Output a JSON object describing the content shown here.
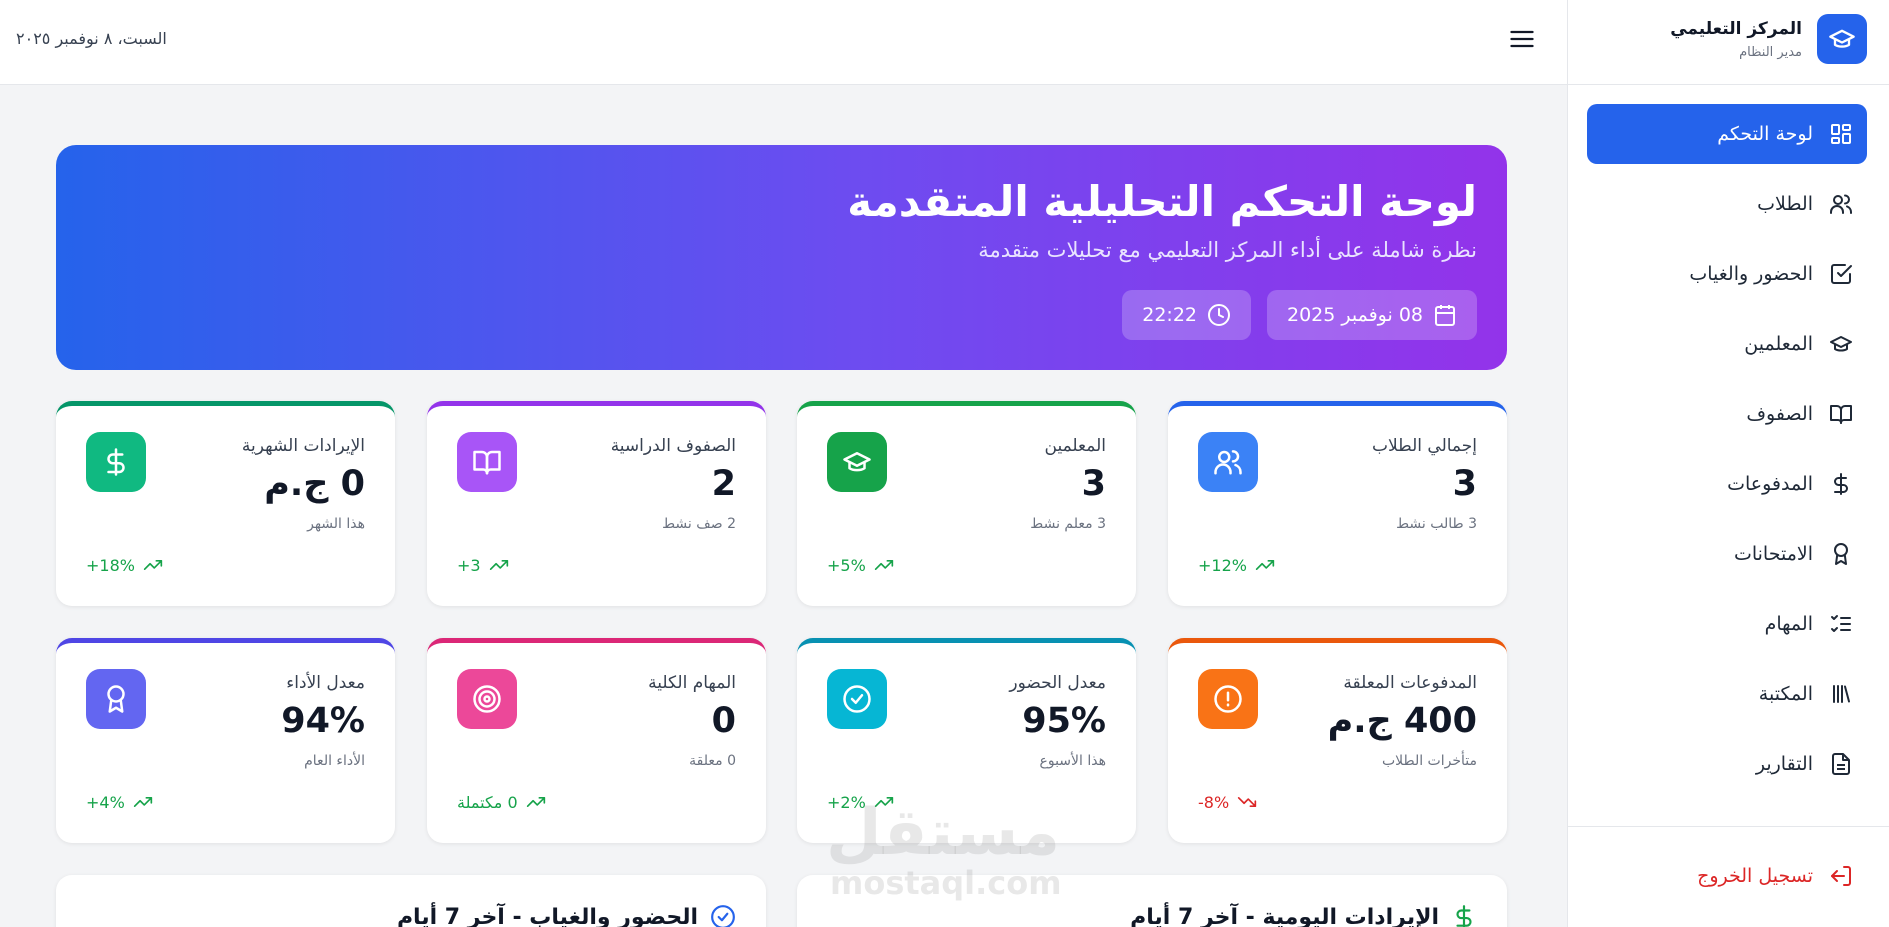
{
  "brand": {
    "title": "المركز التعليمي",
    "subtitle": "مدير النظام",
    "icon": "graduation-cap-icon"
  },
  "topbar": {
    "date": "السبت، ٨ نوفمبر ٢٠٢٥",
    "menu_icon": "menu-icon"
  },
  "sidebar": {
    "items": [
      {
        "label": "لوحة التحكم",
        "icon": "dashboard-icon",
        "active": true
      },
      {
        "label": "الطلاب",
        "icon": "users-icon"
      },
      {
        "label": "الحضور والغياب",
        "icon": "check-square-icon"
      },
      {
        "label": "المعلمين",
        "icon": "graduation-cap-icon"
      },
      {
        "label": "الصفوف",
        "icon": "book-icon"
      },
      {
        "label": "المدفوعات",
        "icon": "dollar-icon"
      },
      {
        "label": "الامتحانات",
        "icon": "award-icon"
      },
      {
        "label": "المهام",
        "icon": "list-checks-icon"
      },
      {
        "label": "المكتبة",
        "icon": "library-icon"
      },
      {
        "label": "التقارير",
        "icon": "file-text-icon"
      }
    ],
    "logout": {
      "label": "تسجيل الخروج",
      "icon": "logout-icon"
    }
  },
  "hero": {
    "title": "لوحة التحكم التحليلية المتقدمة",
    "subtitle": "نظرة شاملة على أداء المركز التعليمي مع تحليلات متقدمة",
    "date_chip": "08 نوفمبر 2025",
    "time_chip": "22:22"
  },
  "stats": [
    {
      "title": "إجمالي الطلاب",
      "value": "3",
      "sub": "3 طالب نشط",
      "trend": "+12%",
      "trend_dir": "up",
      "color": "#3b82f6",
      "icon": "users-icon"
    },
    {
      "title": "المعلمين",
      "value": "3",
      "sub": "3 معلم نشط",
      "trend": "+5%",
      "trend_dir": "up",
      "color": "#16a34a",
      "icon": "graduation-cap-icon"
    },
    {
      "title": "الصفوف الدراسية",
      "value": "2",
      "sub": "2 صف نشط",
      "trend": "+3",
      "trend_dir": "up",
      "color": "#a855f7",
      "icon": "book-icon"
    },
    {
      "title": "الإيرادات الشهرية",
      "value": "0 ج.م",
      "sub": "هذا الشهر",
      "trend": "+18%",
      "trend_dir": "up",
      "color": "#10b981",
      "icon": "dollar-icon"
    },
    {
      "title": "المدفوعات المعلقة",
      "value": "400 ج.م",
      "sub": "متأخرات الطلاب",
      "trend": "-8%",
      "trend_dir": "down",
      "color": "#f97316",
      "icon": "alert-circle-icon"
    },
    {
      "title": "معدل الحضور",
      "value": "95%",
      "sub": "هذا الأسبوع",
      "trend": "+2%",
      "trend_dir": "up",
      "color": "#06b6d4",
      "icon": "check-circle-icon"
    },
    {
      "title": "المهام الكلية",
      "value": "0",
      "sub": "0 معلقة",
      "trend": "0 مكتملة",
      "trend_dir": "up",
      "color": "#ec4899",
      "icon": "target-icon"
    },
    {
      "title": "معدل الأداء",
      "value": "94%",
      "sub": "الأداء العام",
      "trend": "+4%",
      "trend_dir": "up",
      "color": "#6366f1",
      "icon": "award-icon"
    }
  ],
  "panels": [
    {
      "title": "الإيرادات اليومية - آخر 7 أيام",
      "icon": "dollar-icon",
      "color": "#16a34a"
    },
    {
      "title": "الحضور والغياب - آخر 7 أيام",
      "icon": "check-circle-icon",
      "color": "#2563eb"
    }
  ],
  "watermark": {
    "ar": "مستقل",
    "en": "mostaql.com"
  }
}
